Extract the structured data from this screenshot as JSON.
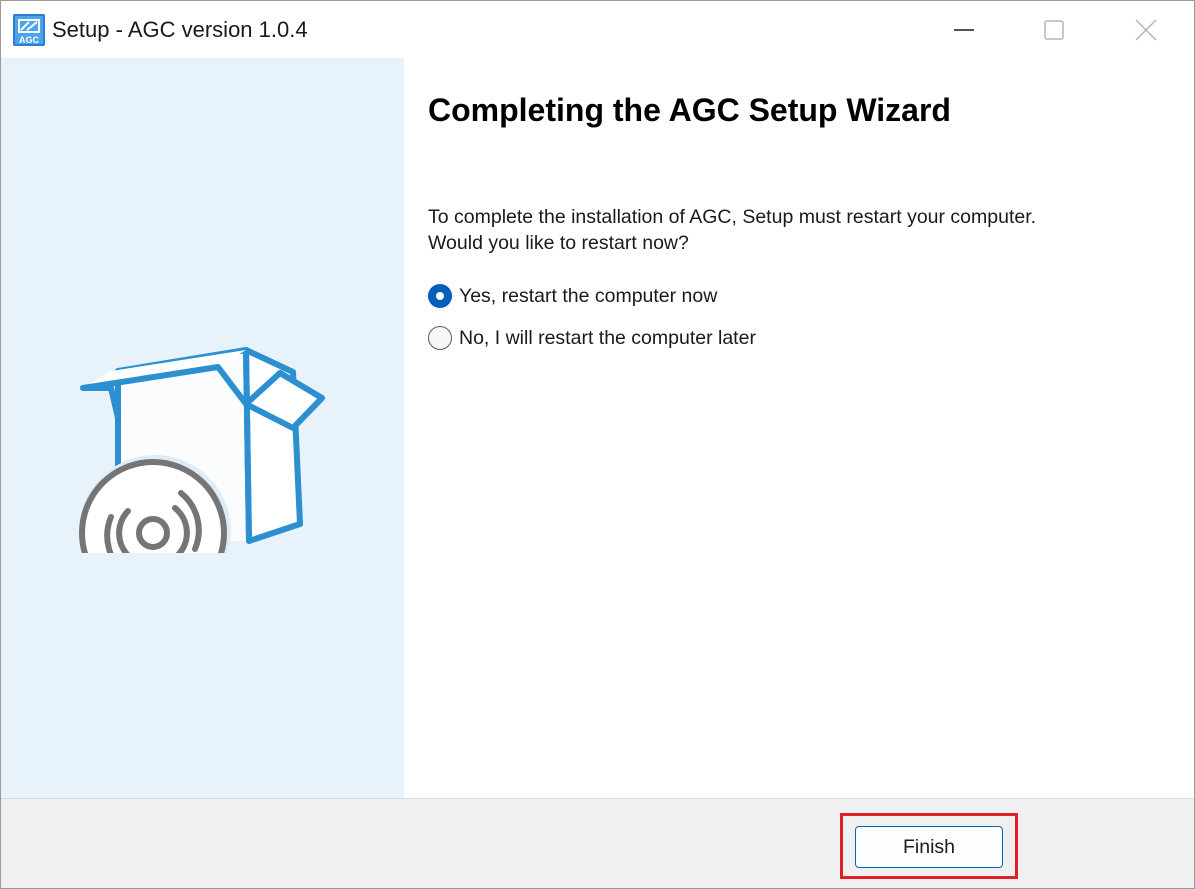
{
  "window": {
    "title": "Setup - AGC version 1.0.4",
    "app_icon_text": "AGC",
    "controls": {
      "minimize_icon": "minimize-icon",
      "maximize_icon": "maximize-icon",
      "close_icon": "close-icon"
    }
  },
  "side_panel": {
    "background": "#e8f2fa",
    "graphic": "box-with-disc-icon",
    "accent": "#2b8fd0",
    "disc_color": "#757575"
  },
  "content": {
    "heading": "Completing the AGC Setup Wizard",
    "message": "To complete the installation of AGC, Setup must restart your computer.\nWould you like to restart now?",
    "options": [
      {
        "label": "Yes, restart the computer now",
        "checked": true
      },
      {
        "label": "No, I will restart the computer later",
        "checked": false
      }
    ]
  },
  "footer": {
    "finish_label": "Finish",
    "highlight_color": "#e0202a",
    "button_border": "#0067c0"
  }
}
